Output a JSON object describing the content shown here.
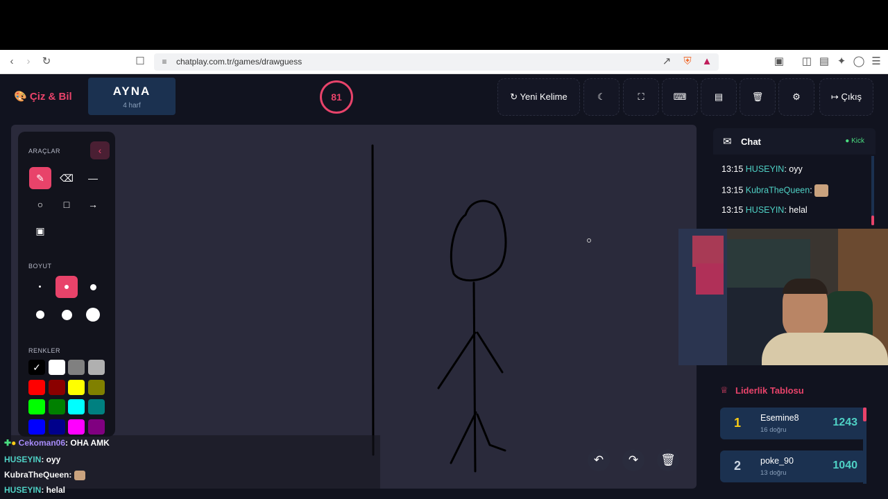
{
  "browser": {
    "url": "chatplay.com.tr/games/drawguess"
  },
  "header": {
    "logo": "Çiz & Bil",
    "word": "AYNA",
    "word_length": "4 harf",
    "timer": "81",
    "new_word": "Yeni Kelime",
    "exit": "Çıkış"
  },
  "tools": {
    "tools_label": "ARAÇLAR",
    "size_label": "BOYUT",
    "colors_label": "RENKLER",
    "colors": [
      "#000000",
      "#ffffff",
      "#808080",
      "#b0b0b0",
      "#ff0000",
      "#8b0000",
      "#ffff00",
      "#808000",
      "#00ff00",
      "#008000",
      "#00ffff",
      "#008080",
      "#0000ff",
      "#00008b",
      "#ff00ff",
      "#800080"
    ]
  },
  "chat": {
    "title": "Chat",
    "status": "Kick",
    "messages": [
      {
        "time": "13:15",
        "user": "HUSEYIN",
        "text": ": oyy"
      },
      {
        "time": "13:15",
        "user": "KubraTheQueen",
        "text": ":"
      },
      {
        "time": "13:15",
        "user": "HUSEYIN",
        "text": ": helal"
      }
    ]
  },
  "leaderboard": {
    "title": "Liderlik Tablosu",
    "rows": [
      {
        "rank": "1",
        "name": "Esemine8",
        "correct": "16 doğru",
        "score": "1243"
      },
      {
        "rank": "2",
        "name": "poke_90",
        "correct": "13 doğru",
        "score": "1040"
      }
    ]
  },
  "overlay": {
    "lines": [
      {
        "user": "Cekoman06",
        "text": ": OHA AMK"
      },
      {
        "user": "HUSEYIN",
        "text": ": oyy"
      },
      {
        "user": "KubraTheQueen",
        "text": ":"
      },
      {
        "user": "HUSEYIN",
        "text": ": helal"
      }
    ]
  }
}
